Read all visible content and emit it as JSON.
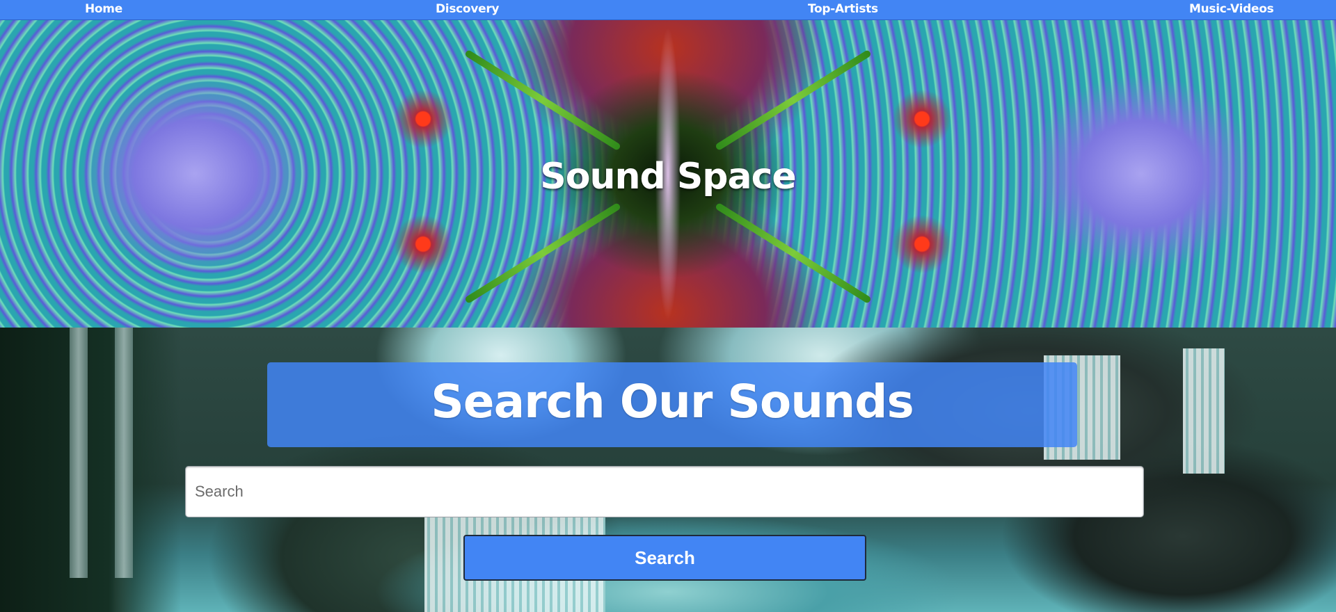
{
  "nav": {
    "items": [
      {
        "label": "Home"
      },
      {
        "label": "Discovery"
      },
      {
        "label": "Top-Artists"
      },
      {
        "label": "Music-Videos"
      }
    ]
  },
  "hero": {
    "title": "Sound Space"
  },
  "search": {
    "heading": "Search Our Sounds",
    "input_placeholder": "Search",
    "input_value": "",
    "button_label": "Search"
  },
  "colors": {
    "accent": "#4285f4",
    "text": "#ffffff"
  }
}
